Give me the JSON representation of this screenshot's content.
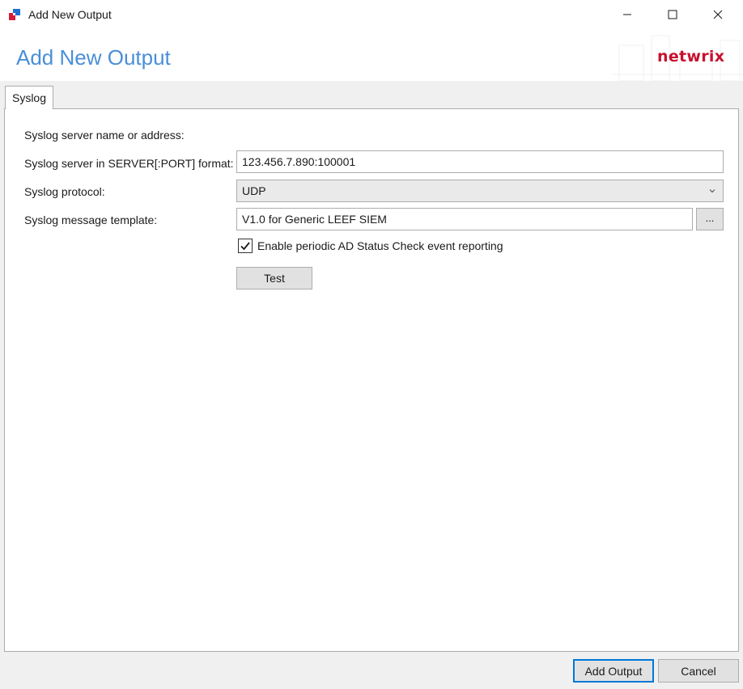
{
  "window": {
    "title": "Add New Output",
    "app_icon": "netwrix-app-icon",
    "controls": [
      "minimize-icon",
      "maximize-icon",
      "close-icon"
    ]
  },
  "header": {
    "title": "Add New Output",
    "brand": "netwrix"
  },
  "tabs": [
    {
      "label": "Syslog",
      "active": true
    }
  ],
  "form": {
    "section_label": "Syslog server name or address:",
    "server_label": "Syslog server in SERVER[:PORT] format:",
    "server_value": "123.456.7.890:100001",
    "protocol_label": "Syslog protocol:",
    "protocol_value": "UDP",
    "template_label": "Syslog message template:",
    "template_value": "V1.0 for Generic LEEF SIEM",
    "browse_label": "...",
    "check_label": "Enable periodic AD Status Check event reporting",
    "check_checked": true,
    "test_label": "Test"
  },
  "footer": {
    "add_label": "Add Output",
    "cancel_label": "Cancel"
  },
  "colors": {
    "title_blue": "#4a8fd8",
    "brand_red": "#c8102e",
    "accent_border": "#0078d7"
  }
}
